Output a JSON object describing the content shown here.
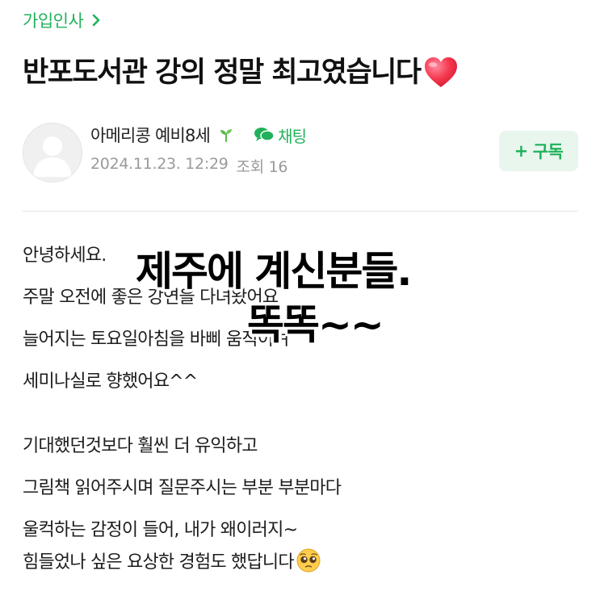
{
  "breadcrumb": {
    "label": "가입인사"
  },
  "post": {
    "title": "반포도서관 강의 정말 최고였습니다",
    "title_emoji": "heart-emoji",
    "author": "아메리콩 예비8세",
    "author_badge": "sprout-icon",
    "chat_label": "채팅",
    "date": "2024.11.23. 12:29",
    "views_label": "조회 16",
    "subscribe_label": "구독"
  },
  "content": {
    "lines": [
      "안녕하세요.",
      "주말 오전에 좋은 강연을 다녀왔어요",
      "늘어지는 토요일아침을 바삐 움직이며",
      "세미나실로 향했어요^^",
      "",
      "기대했던것보다 훨씬 더 유익하고",
      "그림책 읽어주시며 질문주시는 부분 부분마다",
      "울컥하는 감정이 들어, 내가 왜이러지~",
      "힘들었나 싶은 요상한 경험도 했답니다"
    ],
    "last_line_emoji": "pleading-face-emoji"
  },
  "overlay": {
    "line1": "제주에 계신분들.",
    "line2": "똑똑~~"
  },
  "colors": {
    "accent": "#1fb25a",
    "subscribe_bg": "#e8f6ed",
    "meta": "#9a9a9a"
  }
}
